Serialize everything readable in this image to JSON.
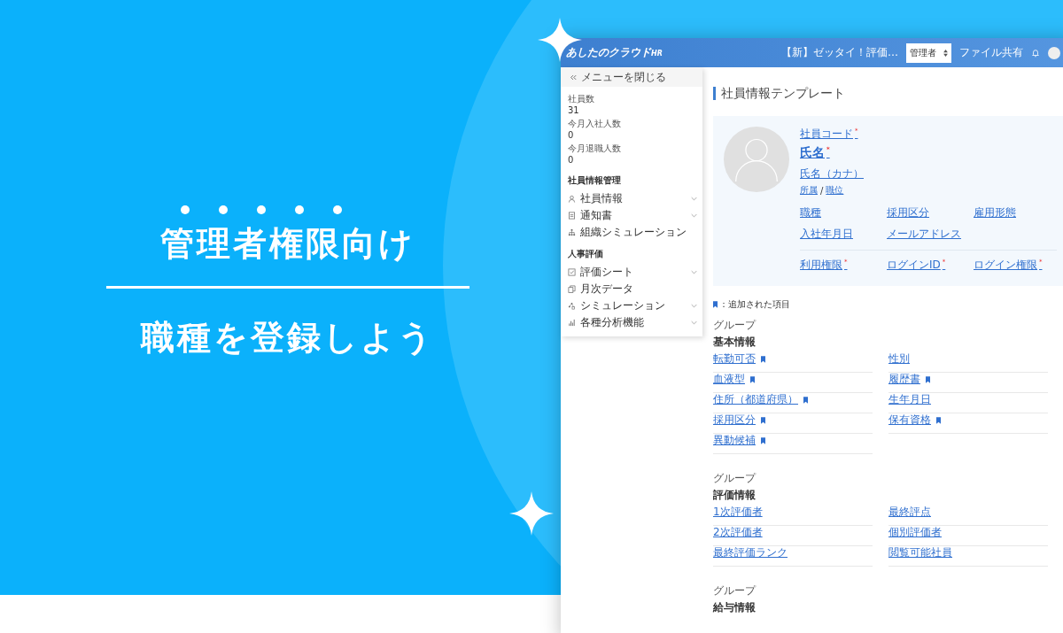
{
  "hero": {
    "headline": "管理者権限向け",
    "subtitle": "職種を登録しよう"
  },
  "app": {
    "logo": "あしたのクラウド",
    "logo_suffix": "HR",
    "notice": "【新】ゼッタイ！評価…",
    "role_select": "管理者",
    "file_share": "ファイル共有",
    "sidebar": {
      "close_menu": "メニューを閉じる",
      "stats": [
        {
          "label": "社員数",
          "value": "31"
        },
        {
          "label": "今月入社人数",
          "value": "0"
        },
        {
          "label": "今月退職人数",
          "value": "0"
        }
      ],
      "sections": [
        {
          "title": "社員情報管理",
          "items": [
            {
              "label": "社員情報",
              "kind": "person",
              "expandable": true
            },
            {
              "label": "通知書",
              "kind": "document",
              "expandable": true
            },
            {
              "label": "組織シミュレーション",
              "kind": "org",
              "expandable": false
            }
          ]
        },
        {
          "title": "人事評価",
          "items": [
            {
              "label": "評価シート",
              "kind": "check",
              "expandable": true
            },
            {
              "label": "月次データ",
              "kind": "copy",
              "expandable": false
            },
            {
              "label": "シミュレーション",
              "kind": "nodes",
              "expandable": true
            },
            {
              "label": "各種分析機能",
              "kind": "bars",
              "expandable": true
            }
          ]
        }
      ]
    },
    "page_title": "社員情報テンプレート",
    "profile": {
      "required_mark": "*",
      "code": {
        "label": "社員コード",
        "required": true
      },
      "name": {
        "label": "氏名",
        "required": true
      },
      "kana": "氏名（カナ）",
      "affiliation": "所属",
      "separator": "/",
      "position": "職位",
      "fields": [
        {
          "label": "職種",
          "required": false
        },
        {
          "label": "採用区分",
          "required": false
        },
        {
          "label": "雇用形態",
          "required": false
        },
        {
          "label": "入社年月日",
          "required": false
        },
        {
          "label": "メールアドレス",
          "required": false
        }
      ],
      "login_fields": [
        {
          "label": "利用権限",
          "required": true
        },
        {
          "label": "ログインID",
          "required": true
        },
        {
          "label": "ログイン権限",
          "required": true
        }
      ]
    },
    "legend": "：追加された項目",
    "groups": [
      {
        "caption": "グループ",
        "title": "基本情報",
        "items": [
          {
            "label": "転勤可否",
            "added": true
          },
          {
            "label": "性別",
            "added": false
          },
          {
            "label": "血液型",
            "added": true
          },
          {
            "label": "履歴書",
            "added": true
          },
          {
            "label": "住所（都道府県）",
            "added": true
          },
          {
            "label": "生年月日",
            "added": false
          },
          {
            "label": "採用区分",
            "added": true
          },
          {
            "label": "保有資格",
            "added": true
          },
          {
            "label": "異動候補",
            "added": true
          }
        ]
      },
      {
        "caption": "グループ",
        "title": "評価情報",
        "items": [
          {
            "label": "1次評価者",
            "added": false
          },
          {
            "label": "最終評点",
            "added": false
          },
          {
            "label": "2次評価者",
            "added": false
          },
          {
            "label": "個別評価者",
            "added": false
          },
          {
            "label": "最終評価ランク",
            "added": false
          },
          {
            "label": "閲覧可能社員",
            "added": false
          }
        ]
      },
      {
        "caption": "グループ",
        "title": "給与情報"
      }
    ]
  }
}
